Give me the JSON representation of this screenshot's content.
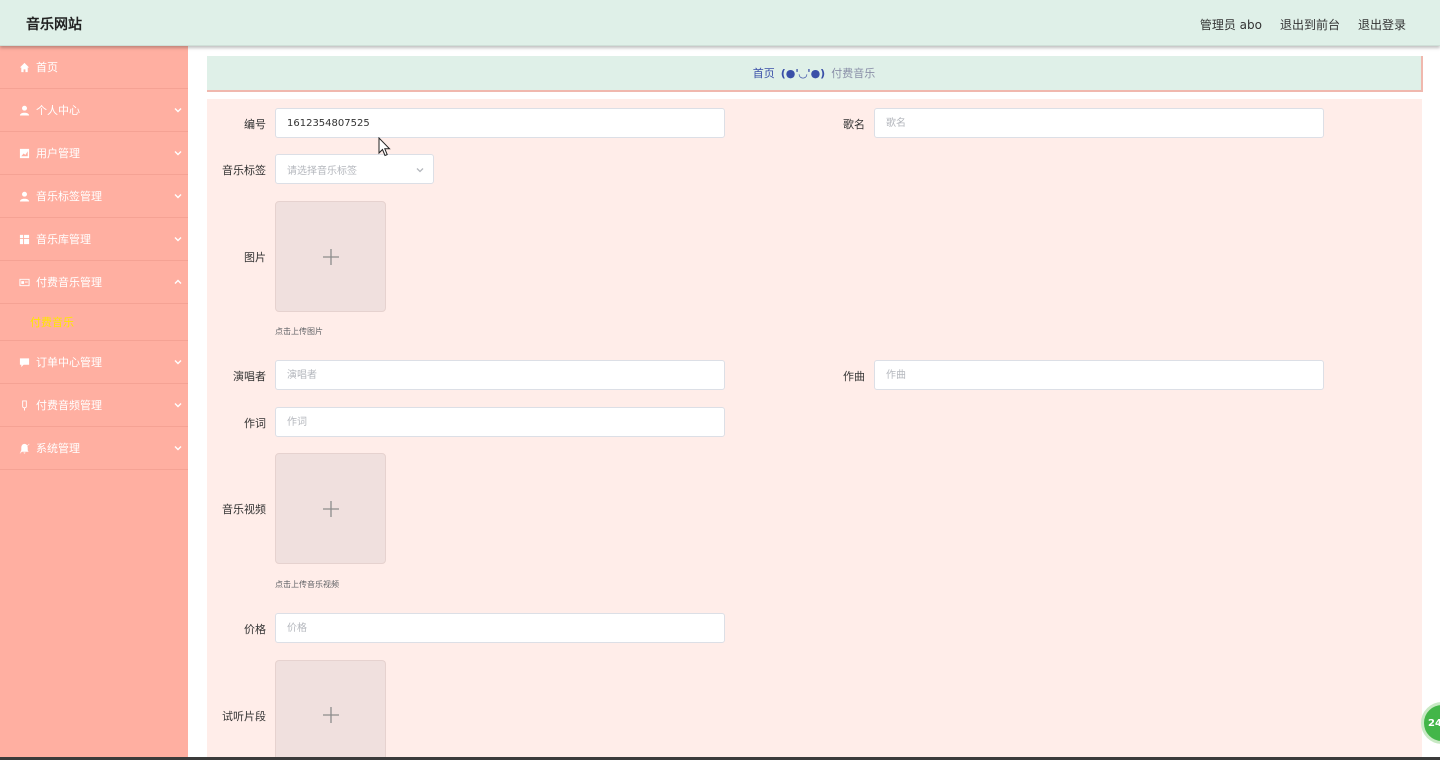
{
  "header": {
    "brand": "音乐网站",
    "admin_label": "管理员 abo",
    "to_front": "退出到前台",
    "logout": "退出登录"
  },
  "sidebar": {
    "items": [
      {
        "label": "首页",
        "icon": "home-icon"
      },
      {
        "label": "个人中心",
        "icon": "user-icon"
      },
      {
        "label": "用户管理",
        "icon": "chart-icon"
      },
      {
        "label": "音乐标签管理",
        "icon": "user-icon"
      },
      {
        "label": "音乐库管理",
        "icon": "grid-icon"
      },
      {
        "label": "付费音乐管理",
        "icon": "card-icon"
      },
      {
        "label": "订单中心管理",
        "icon": "chat-icon"
      },
      {
        "label": "付费音频管理",
        "icon": "medal-icon"
      },
      {
        "label": "系统管理",
        "icon": "bell-off-icon"
      }
    ],
    "active_sub": "付费音乐"
  },
  "breadcrumb": {
    "home": "首页",
    "separator": "(●'◡'●)",
    "current": "付费音乐"
  },
  "form": {
    "number_label": "编号",
    "number_value": "1612354807525",
    "song_label": "歌名",
    "song_placeholder": "歌名",
    "tag_label": "音乐标签",
    "tag_placeholder": "请选择音乐标签",
    "image_label": "图片",
    "image_tip": "点击上传图片",
    "singer_label": "演唱者",
    "singer_placeholder": "演唱者",
    "composer_label": "作曲",
    "composer_placeholder": "作曲",
    "lyricist_label": "作词",
    "lyricist_placeholder": "作词",
    "video_label": "音乐视频",
    "video_tip": "点击上传音乐视频",
    "price_label": "价格",
    "price_placeholder": "价格",
    "preview_label": "试听片段"
  },
  "badge": "24"
}
